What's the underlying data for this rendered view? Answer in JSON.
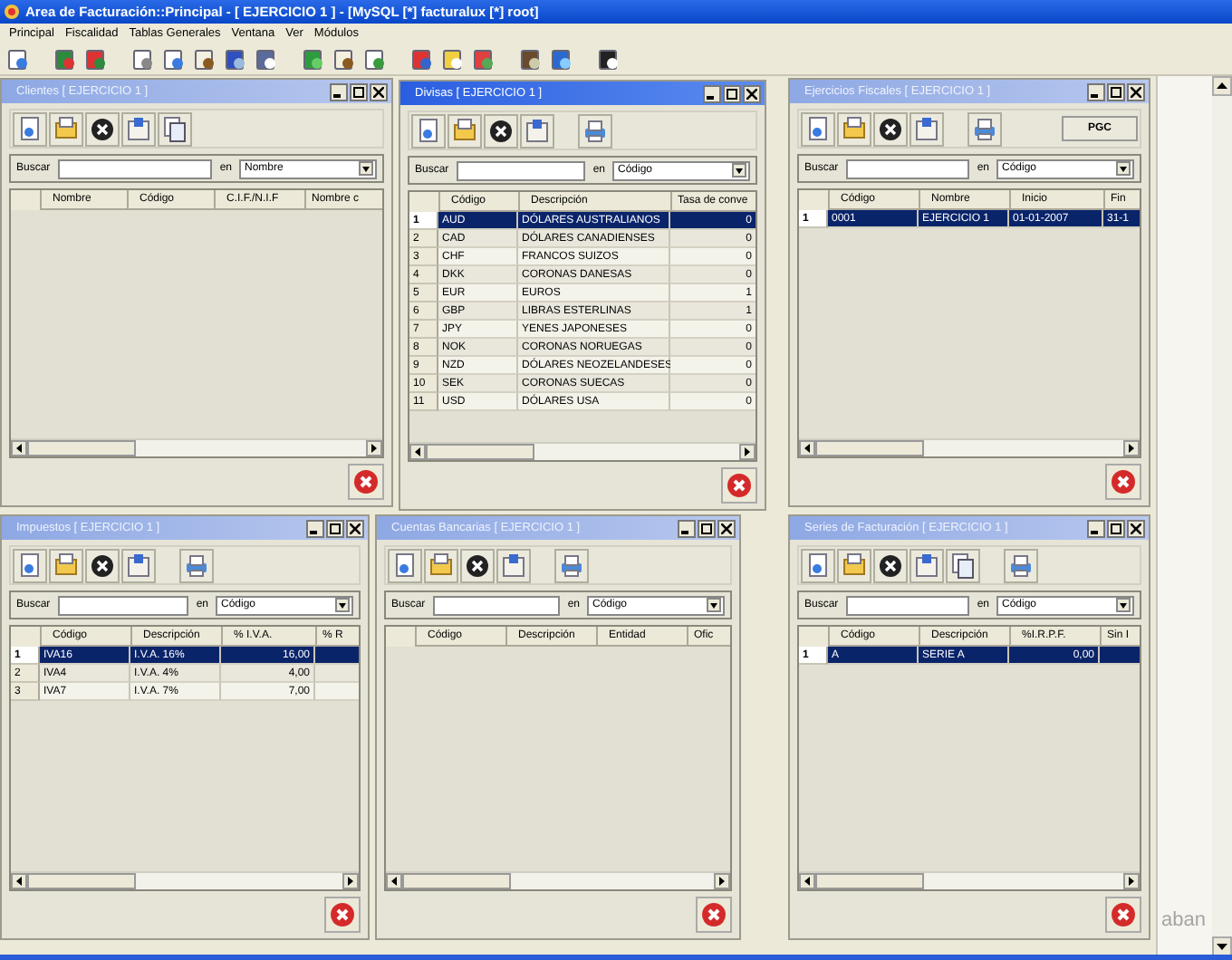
{
  "window": {
    "title": "Area de Facturación::Principal  - [ EJERCICIO 1 ] - [MySQL [*] facturalux [*] root]"
  },
  "menu": [
    "Principal",
    "Fiscalidad",
    "Tablas Generales",
    "Ventana",
    "Ver",
    "Módulos"
  ],
  "windows": [
    {
      "title": "Clientes [ EJERCICIO 1 ]",
      "active": false,
      "copy_button": true,
      "print_button": false,
      "search_label": "Buscar",
      "in_label": "en",
      "search_in": "Nombre",
      "columns": [
        {
          "label": "Nombre"
        },
        {
          "label": "Código"
        },
        {
          "label": "C.I.F./N.I.F"
        },
        {
          "label": "Nombre c"
        }
      ]
    },
    {
      "title": "Divisas [ EJERCICIO 1 ]",
      "active": true,
      "copy_button": false,
      "print_button": true,
      "search_label": "Buscar",
      "in_label": "en",
      "search_in": "Código",
      "columns": [
        {
          "label": "Código",
          "kind": "text"
        },
        {
          "label": "Descripción",
          "kind": "text"
        },
        {
          "label": "Tasa de conve",
          "kind": "number"
        }
      ],
      "rows": [
        {
          "number": "1",
          "cells": [
            "AUD",
            "DÓLARES AUSTRALIANOS",
            "0"
          ],
          "selected": true
        },
        {
          "number": "2",
          "cells": [
            "CAD",
            "DÓLARES CANADIENSES",
            "0"
          ],
          "selected": false
        },
        {
          "number": "3",
          "cells": [
            "CHF",
            "FRANCOS SUIZOS",
            "0"
          ],
          "selected": false
        },
        {
          "number": "4",
          "cells": [
            "DKK",
            "CORONAS DANESAS",
            "0"
          ],
          "selected": false
        },
        {
          "number": "5",
          "cells": [
            "EUR",
            "EUROS",
            "1"
          ],
          "selected": false
        },
        {
          "number": "6",
          "cells": [
            "GBP",
            "LIBRAS ESTERLINAS",
            "1"
          ],
          "selected": false
        },
        {
          "number": "7",
          "cells": [
            "JPY",
            "YENES JAPONESES",
            "0"
          ],
          "selected": false
        },
        {
          "number": "8",
          "cells": [
            "NOK",
            "CORONAS NORUEGAS",
            "0"
          ],
          "selected": false
        },
        {
          "number": "9",
          "cells": [
            "NZD",
            "DÓLARES NEOZELANDESES",
            "0"
          ],
          "selected": false
        },
        {
          "number": "10",
          "cells": [
            "SEK",
            "CORONAS SUECAS",
            "0"
          ],
          "selected": false
        },
        {
          "number": "11",
          "cells": [
            "USD",
            "DÓLARES USA",
            "0"
          ],
          "selected": false
        }
      ]
    },
    {
      "title": "Ejercicios Fiscales [ EJERCICIO 1 ]",
      "active": false,
      "copy_button": false,
      "print_button": true,
      "extra_button": "PGC",
      "search_label": "Buscar",
      "in_label": "en",
      "search_in": "Código",
      "columns": [
        {
          "label": "Código",
          "kind": "text"
        },
        {
          "label": "Nombre",
          "kind": "text"
        },
        {
          "label": "Inicio",
          "kind": "text"
        },
        {
          "label": "Fin",
          "kind": "text"
        }
      ],
      "rows": [
        {
          "number": "1",
          "cells": [
            "0001",
            "EJERCICIO 1",
            "01-01-2007",
            "31-1"
          ],
          "selected": true
        }
      ]
    },
    {
      "title": "Impuestos [ EJERCICIO 1 ]",
      "active": false,
      "copy_button": false,
      "print_button": true,
      "search_label": "Buscar",
      "in_label": "en",
      "search_in": "Código",
      "columns": [
        {
          "label": "Código",
          "kind": "text"
        },
        {
          "label": "Descripción",
          "kind": "text"
        },
        {
          "label": "% I.V.A.",
          "kind": "number"
        },
        {
          "label": "% R",
          "kind": "text"
        }
      ],
      "rows": [
        {
          "number": "1",
          "cells": [
            "IVA16",
            "I.V.A. 16%",
            "16,00"
          ],
          "selected": true
        },
        {
          "number": "2",
          "cells": [
            "IVA4",
            "I.V.A. 4%",
            "4,00"
          ],
          "selected": false
        },
        {
          "number": "3",
          "cells": [
            "IVA7",
            "I.V.A. 7%",
            "7,00"
          ],
          "selected": false
        }
      ]
    },
    {
      "title": "Cuentas Bancarias [ EJERCICIO 1 ]",
      "active": false,
      "copy_button": false,
      "print_button": true,
      "search_label": "Buscar",
      "in_label": "en",
      "search_in": "Código",
      "columns": [
        {
          "label": "Código"
        },
        {
          "label": "Descripción"
        },
        {
          "label": "Entidad"
        },
        {
          "label": "Ofic"
        }
      ]
    },
    {
      "title": "Series de Facturación [ EJERCICIO 1 ]",
      "active": false,
      "copy_button": true,
      "print_button": true,
      "search_label": "Buscar",
      "in_label": "en",
      "search_in": "Código",
      "columns": [
        {
          "label": "Código",
          "kind": "text"
        },
        {
          "label": "Descripción",
          "kind": "text"
        },
        {
          "label": "%I.R.P.F.",
          "kind": "number"
        },
        {
          "label": "Sin I",
          "kind": "text"
        }
      ],
      "rows": [
        {
          "number": "1",
          "cells": [
            "A",
            "SERIE A",
            "0,00"
          ],
          "selected": true
        }
      ]
    }
  ],
  "background_logo": "aban"
}
